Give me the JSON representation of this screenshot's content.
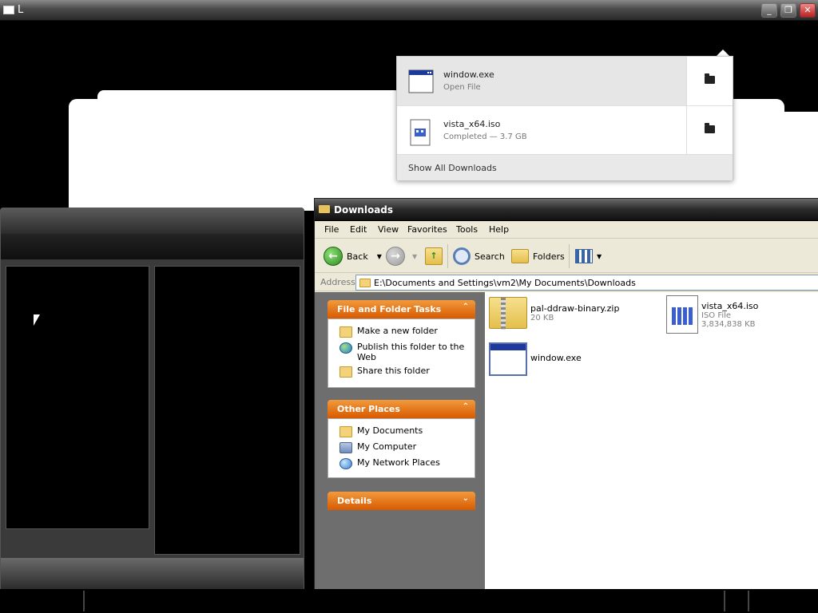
{
  "outer_window": {
    "title": "L"
  },
  "downloads_popup": {
    "items": [
      {
        "name": "window.exe",
        "status": "Open File"
      },
      {
        "name": "vista_x64.iso",
        "status": "Completed — 3.7 GB"
      }
    ],
    "show_all": "Show All Downloads"
  },
  "explorer": {
    "title": "Downloads",
    "menu": [
      "File",
      "Edit",
      "View",
      "Favorites",
      "Tools",
      "Help"
    ],
    "toolbar": {
      "back": "Back",
      "search": "Search",
      "folders": "Folders"
    },
    "address": {
      "label": "Address",
      "value": "E:\\Documents and Settings\\vm2\\My Documents\\Downloads"
    },
    "file_tasks": {
      "header": "File and Folder Tasks",
      "items": [
        "Make a new folder",
        "Publish this folder to the Web",
        "Share this folder"
      ]
    },
    "other_places": {
      "header": "Other Places",
      "items": [
        "My Documents",
        "My Computer",
        "My Network Places"
      ]
    },
    "details": {
      "header": "Details"
    },
    "files": [
      {
        "name": "pal-ddraw-binary.zip",
        "sub": "20 KB",
        "icon": "zip-folder-icon"
      },
      {
        "name": "vista_x64.iso",
        "sub": "ISO File",
        "sub2": "3,834,838 KB",
        "icon": "iso-file-icon"
      },
      {
        "name": "window.exe",
        "icon": "exe-window-icon"
      }
    ]
  }
}
